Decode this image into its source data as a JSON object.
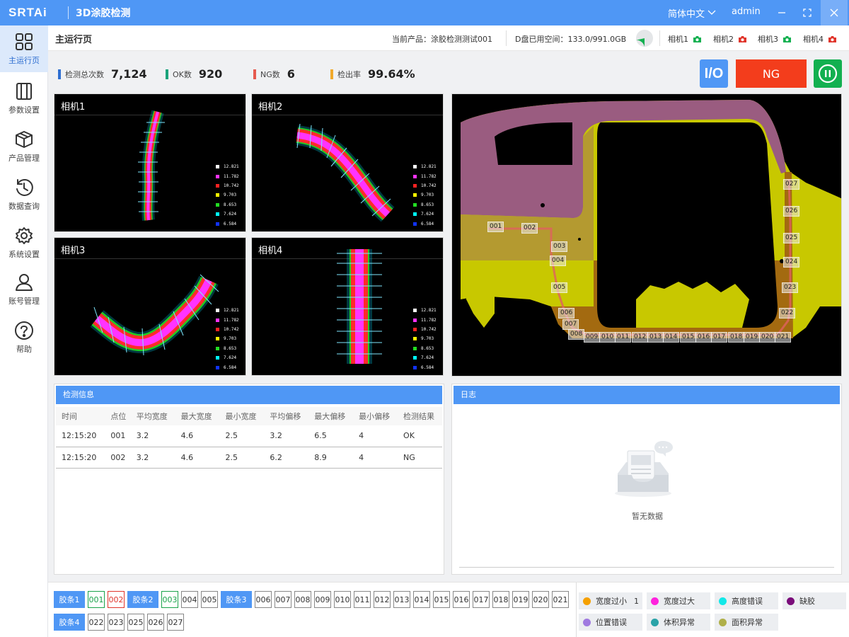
{
  "titlebar": {
    "logo": "SRTAi",
    "app_title": "3D涂胶检测",
    "language": "简体中文",
    "user": "admin"
  },
  "sidebar": {
    "items": [
      {
        "label": "主运行页",
        "icon": "dashboard-grid-icon",
        "active": true
      },
      {
        "label": "参数设置",
        "icon": "panels-icon",
        "active": false
      },
      {
        "label": "产品管理",
        "icon": "box-icon",
        "active": false
      },
      {
        "label": "数据查询",
        "icon": "history-icon",
        "active": false
      },
      {
        "label": "系统设置",
        "icon": "gear-icon",
        "active": false
      },
      {
        "label": "账号管理",
        "icon": "user-icon",
        "active": false
      },
      {
        "label": "帮助",
        "icon": "help-icon",
        "active": false
      }
    ]
  },
  "header": {
    "page_title": "主运行页",
    "current_product": "当前产品：涂胶检测测试001",
    "disk_usage": "D盘已用空间：133.0/991.0GB",
    "disk_used_fraction": 0.134,
    "cameras": [
      {
        "label": "相机1",
        "status": "ok"
      },
      {
        "label": "相机2",
        "status": "error"
      },
      {
        "label": "相机3",
        "status": "ok"
      },
      {
        "label": "相机4",
        "status": "error"
      }
    ]
  },
  "stats": [
    {
      "label": "检测总次数",
      "value": "7,124",
      "color": "#2f6fd1"
    },
    {
      "label": "OK数",
      "value": "920",
      "color": "#1aa37a"
    },
    {
      "label": "NG数",
      "value": "6",
      "color": "#e65a4f"
    },
    {
      "label": "检出率",
      "value": "99.64%",
      "color": "#f0a92b"
    }
  ],
  "controls": {
    "io_label": "I/O",
    "result_label": "NG",
    "result_color": "#f33d1c",
    "pause_icon": "pause-icon"
  },
  "camera_views": [
    {
      "title": "相机1"
    },
    {
      "title": "相机2"
    },
    {
      "title": "相机3"
    },
    {
      "title": "相机4"
    }
  ],
  "legend": [
    {
      "value": "12.821",
      "color": "#ffffff"
    },
    {
      "value": "11.782",
      "color": "#ff33ff"
    },
    {
      "value": "10.742",
      "color": "#ff2222"
    },
    {
      "value": "9.703",
      "color": "#ffff00"
    },
    {
      "value": "8.653",
      "color": "#22dd22"
    },
    {
      "value": "7.624",
      "color": "#00ffff"
    },
    {
      "value": "6.584",
      "color": "#1133ff"
    }
  ],
  "overview_points": [
    "001",
    "002",
    "003",
    "004",
    "005",
    "006",
    "007",
    "008",
    "009",
    "010",
    "011",
    "012",
    "013",
    "014",
    "015",
    "016",
    "017",
    "018",
    "019",
    "020",
    "021",
    "022",
    "023",
    "024",
    "025",
    "026",
    "027"
  ],
  "detect_info": {
    "title": "检测信息",
    "columns": [
      "时间",
      "点位",
      "平均宽度",
      "最大宽度",
      "最小宽度",
      "平均偏移",
      "最大偏移",
      "最小偏移",
      "检测结果"
    ],
    "rows": [
      [
        "12:15:20",
        "001",
        "3.2",
        "4.6",
        "2.5",
        "3.2",
        "6.5",
        "4",
        "OK"
      ],
      [
        "12:15:20",
        "002",
        "3.2",
        "4.6",
        "2.5",
        "6.2",
        "8.9",
        "4",
        "NG"
      ]
    ]
  },
  "log": {
    "title": "日志",
    "empty_text": "暂无数据"
  },
  "strips": [
    {
      "label": "胶条1",
      "points": [
        {
          "id": "001",
          "state": "ok"
        },
        {
          "id": "002",
          "state": "ng"
        }
      ]
    },
    {
      "label": "胶条2",
      "points": [
        {
          "id": "003",
          "state": "ok"
        },
        {
          "id": "004",
          "state": "none"
        },
        {
          "id": "005",
          "state": "none"
        }
      ]
    },
    {
      "label": "胶条3",
      "points": [
        {
          "id": "006"
        },
        {
          "id": "007"
        },
        {
          "id": "008"
        },
        {
          "id": "009"
        },
        {
          "id": "010"
        },
        {
          "id": "011"
        },
        {
          "id": "012"
        },
        {
          "id": "013"
        },
        {
          "id": "014"
        },
        {
          "id": "015"
        },
        {
          "id": "016"
        },
        {
          "id": "017"
        },
        {
          "id": "018"
        },
        {
          "id": "019"
        },
        {
          "id": "020"
        },
        {
          "id": "021"
        }
      ]
    },
    {
      "label": "胶条4",
      "points": [
        {
          "id": "022"
        },
        {
          "id": "023"
        },
        {
          "id": "025"
        },
        {
          "id": "026"
        },
        {
          "id": "027"
        }
      ]
    }
  ],
  "error_types": [
    {
      "label": "宽度过小",
      "count": "1",
      "color": "#f5a000"
    },
    {
      "label": "宽度过大",
      "count": "",
      "color": "#ff22dd"
    },
    {
      "label": "高度错误",
      "count": "",
      "color": "#11e8e8"
    },
    {
      "label": "缺胶",
      "count": "",
      "color": "#7a0c7a"
    },
    {
      "label": "位置错误",
      "count": "",
      "color": "#a07ae0"
    },
    {
      "label": "体积异常",
      "count": "",
      "color": "#2aa3a8"
    },
    {
      "label": "面积异常",
      "count": "",
      "color": "#b0b04a"
    }
  ]
}
